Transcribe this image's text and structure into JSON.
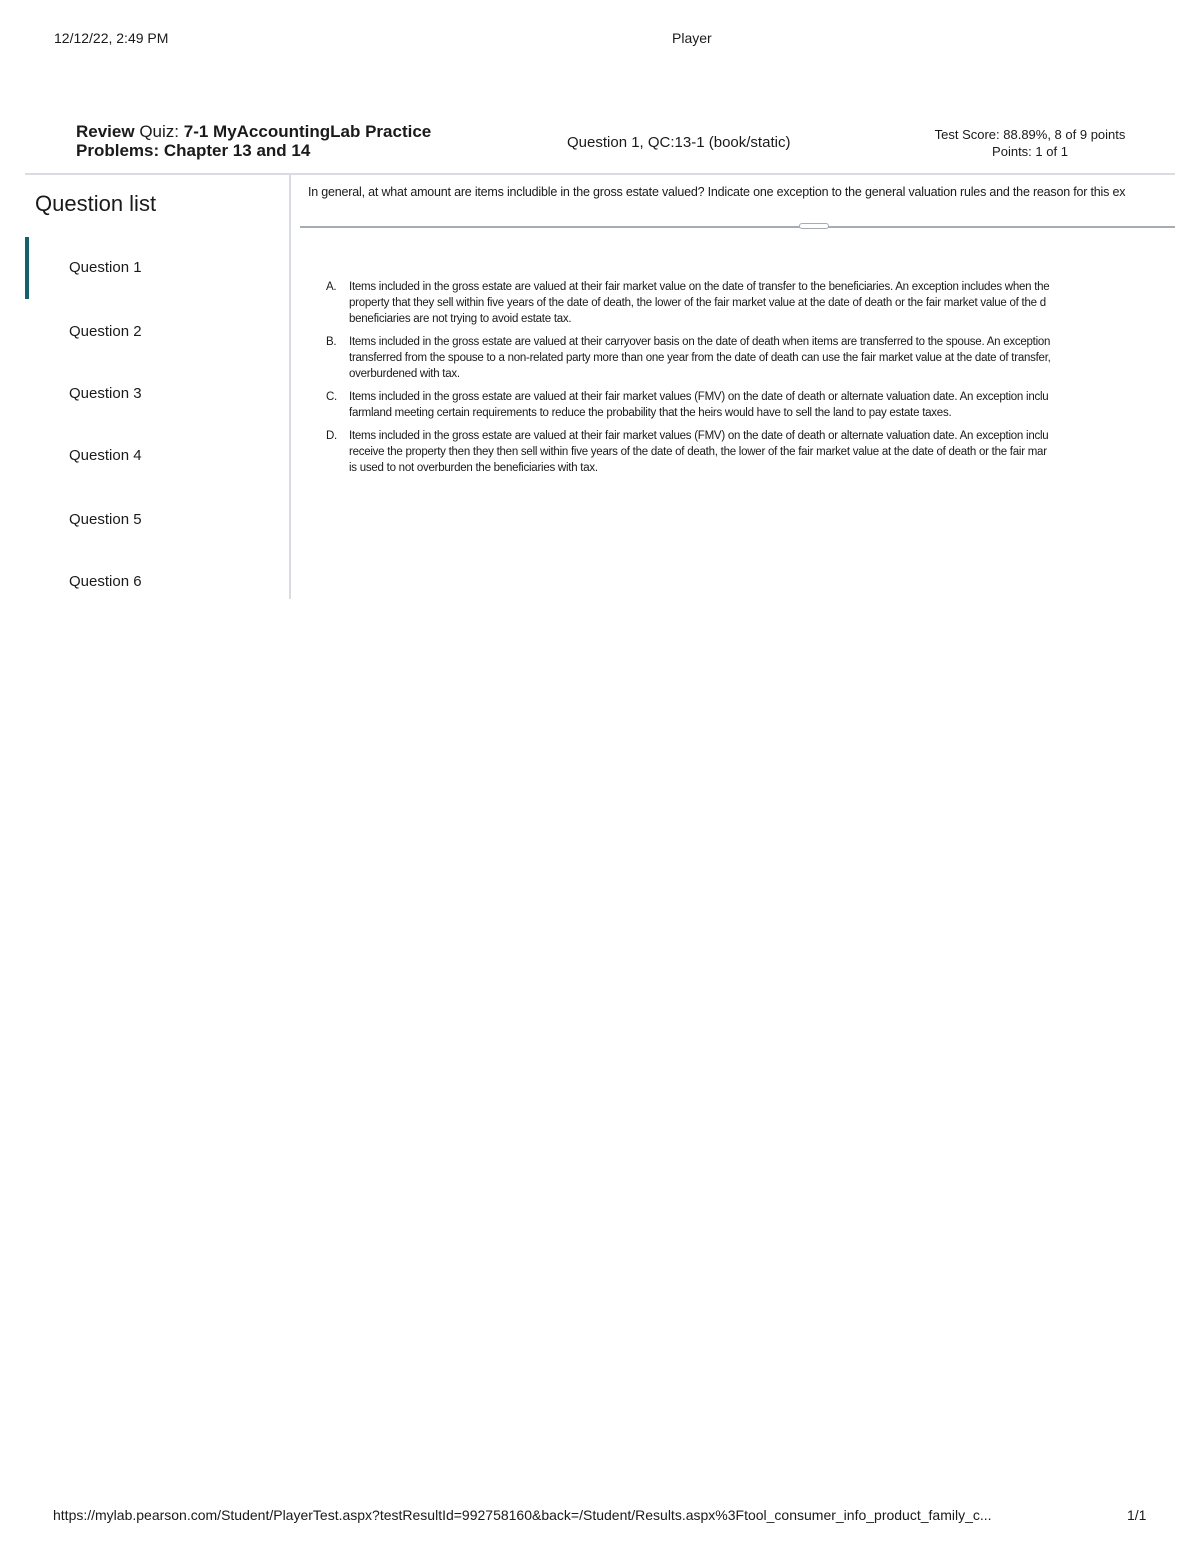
{
  "print_header": {
    "datetime": "12/12/22, 2:49 PM",
    "title": "Player"
  },
  "quiz_header": {
    "title_prefix_bold": "Review",
    "title_prefix_light": "Quiz:",
    "title_name": "7-1 MyAccountingLab Practice Problems: Chapter 13 and 14",
    "question_id": "Question 1, QC:13-1 (book/static)",
    "test_score": "Test Score: 88.89%, 8 of 9 points",
    "points": "Points: 1 of 1"
  },
  "sidebar": {
    "title": "Question list",
    "items": [
      {
        "label": "Question 1",
        "active": true
      },
      {
        "label": "Question 2",
        "active": false
      },
      {
        "label": "Question 3",
        "active": false
      },
      {
        "label": "Question 4",
        "active": false
      },
      {
        "label": "Question 5",
        "active": false
      },
      {
        "label": "Question 6",
        "active": false
      }
    ]
  },
  "question": {
    "prompt": "In general, at what amount are items includible in the gross estate valued? Indicate one exception to the general valuation rules and the reason for this ex",
    "choices": [
      {
        "letter": "A.",
        "lines": [
          "Items included in the gross estate are valued at their fair market value on the date of transfer to the beneficiaries. An exception includes when the",
          "property that they sell within five years of the date of death, the lower of the fair market value at the date of death or the fair market value of the d",
          "beneficiaries are not trying to avoid estate tax."
        ]
      },
      {
        "letter": "B.",
        "lines": [
          "Items included in the gross estate are valued at their carryover basis on the date of death when items are transferred to the spouse. An exception",
          "transferred from the spouse to a non-related party more than one year from the date of death can use the fair market value at the date of transfer,",
          "overburdened with tax."
        ]
      },
      {
        "letter": "C.",
        "lines": [
          "Items included in the gross estate are valued at their fair market values (FMV) on the date of death or alternate valuation date. An exception inclu",
          "farmland meeting certain requirements to reduce the probability that the heirs would have to sell the land to pay estate taxes."
        ]
      },
      {
        "letter": "D.",
        "lines": [
          "Items included in the gross estate are valued at their fair market values (FMV) on the date of death or alternate valuation date. An exception inclu",
          "receive the property then they then sell within five years of the date of death, the lower of the fair market value at the date of death or the fair mar",
          "is used to not overburden the beneficiaries with tax."
        ]
      }
    ]
  },
  "print_footer": {
    "url": "https://mylab.pearson.com/Student/PlayerTest.aspx?testResultId=992758160&back=/Student/Results.aspx%3Ftool_consumer_info_product_family_c...",
    "page": "1/1"
  },
  "colors": {
    "accent": "#14606b",
    "divider": "#a7acb2",
    "rule": "#d9dde3"
  }
}
